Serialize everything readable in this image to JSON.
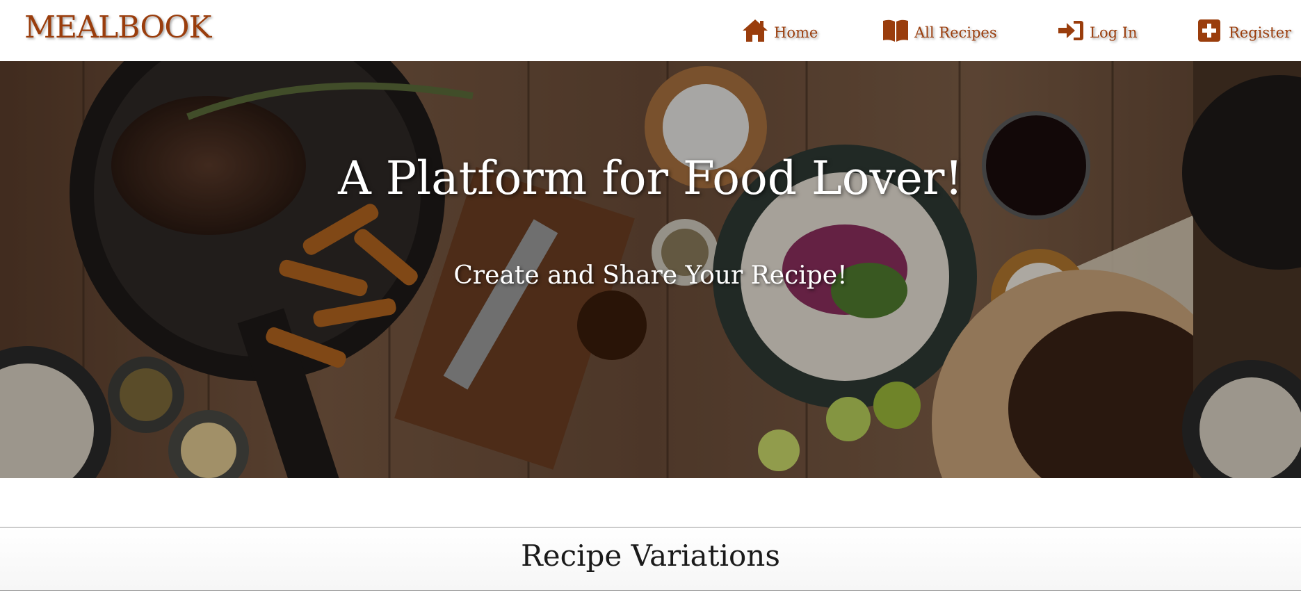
{
  "navbar": {
    "brand": "MEALBOOK",
    "links": [
      {
        "label": "Home",
        "icon": "home-icon"
      },
      {
        "label": "All Recipes",
        "icon": "book-icon"
      },
      {
        "label": "Log In",
        "icon": "sign-in-icon"
      },
      {
        "label": "Register",
        "icon": "plus-square-icon"
      }
    ]
  },
  "hero": {
    "title": "A Platform for Food Lover!",
    "subtitle": "Create and Share Your Recipe!"
  },
  "section": {
    "title": "Recipe Variations"
  },
  "colors": {
    "brand": "#9a3d0c",
    "hero_text": "#ffffff",
    "section_text": "#1a1a1a"
  }
}
